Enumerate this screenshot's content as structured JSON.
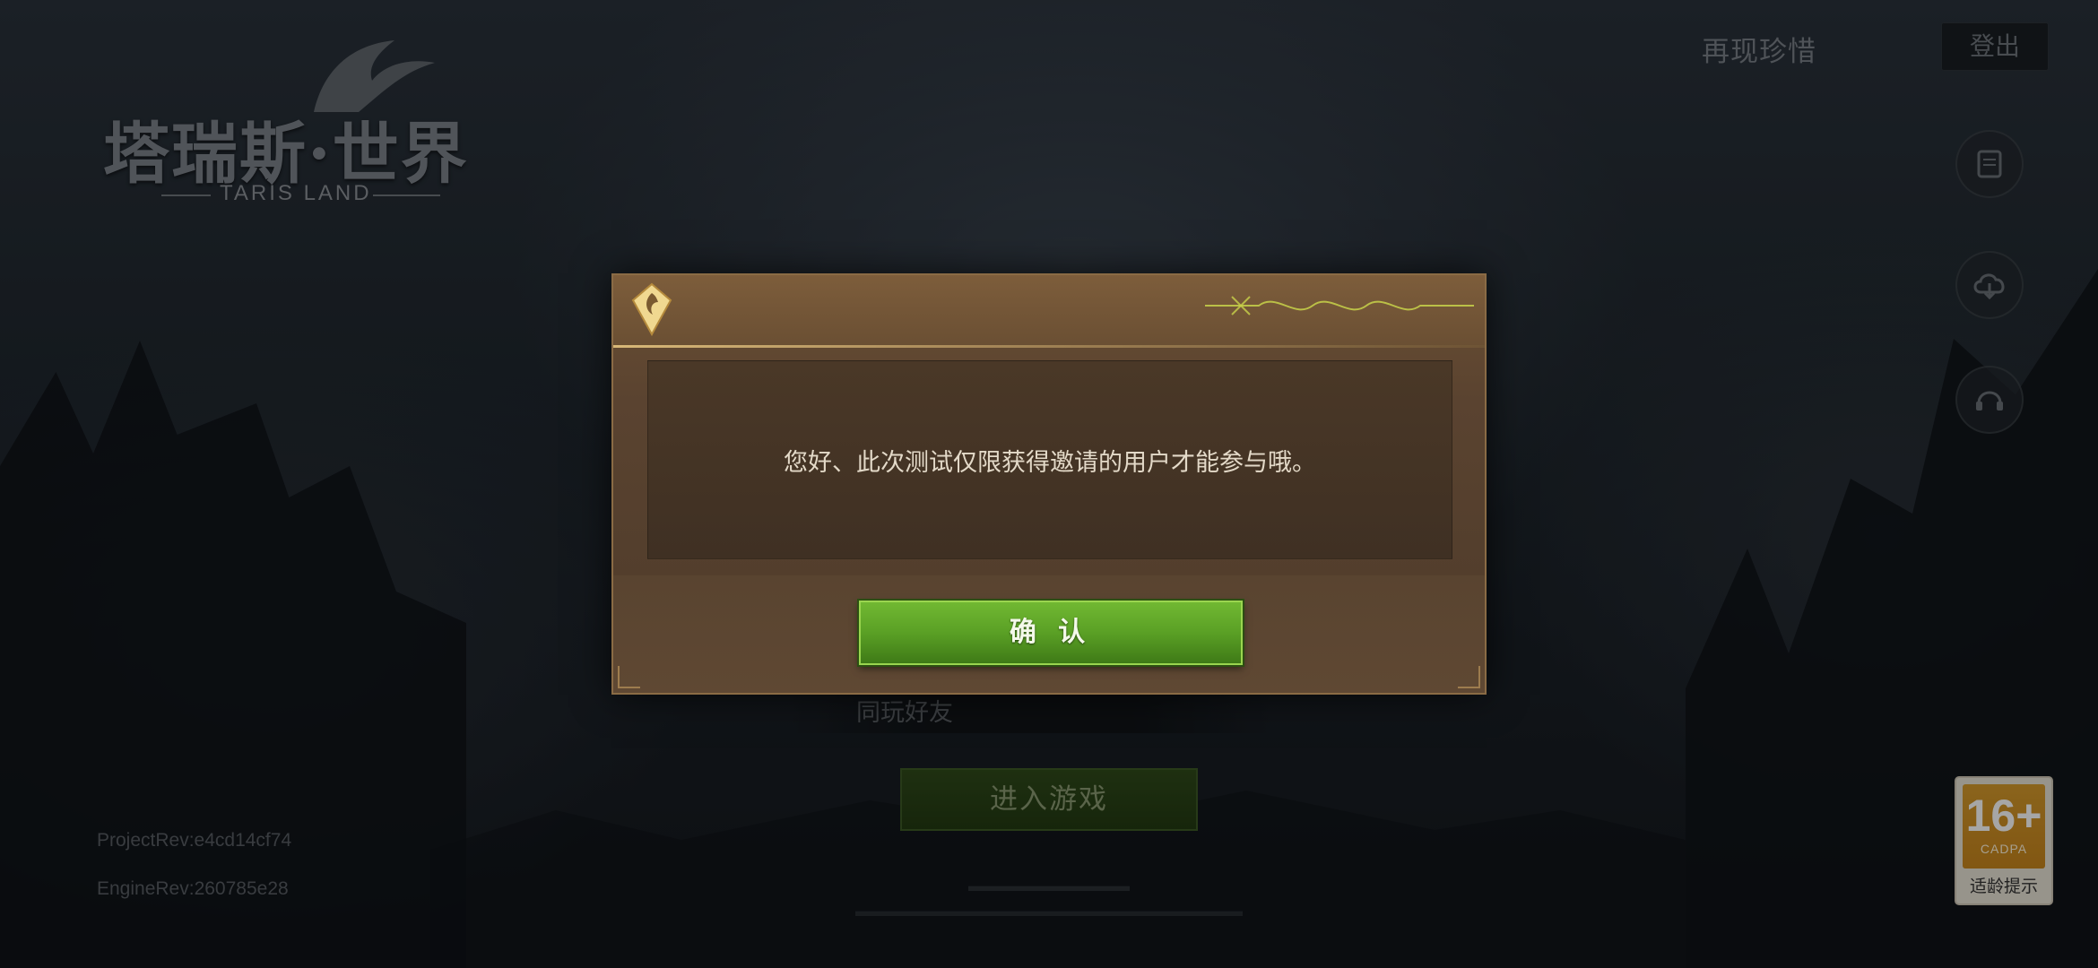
{
  "logo": {
    "title_cn": "塔瑞斯·世界",
    "title_en": "TARIS LAND"
  },
  "header": {
    "link_label": "再现珍惜",
    "logout_label": "登出"
  },
  "side_icons": [
    "scroll-icon",
    "cloud-download-icon",
    "customer-service-icon"
  ],
  "dialog": {
    "message": "您好、此次测试仅限获得邀请的用户才能参与哦。",
    "confirm_label": "确 认"
  },
  "background_ui": {
    "friends_label": "同玩好友",
    "enter_label": "进入游戏",
    "project_rev": "ProjectRev:e4cd14cf74",
    "engine_rev": "EngineRev:260785e28"
  },
  "age_rating": {
    "rating": "16+",
    "org": "CADPA",
    "hint": "适龄提示"
  },
  "colors": {
    "confirm_green": "#5aa025",
    "dialog_brown": "#5a4330",
    "rating_orange": "#d59a2c"
  }
}
